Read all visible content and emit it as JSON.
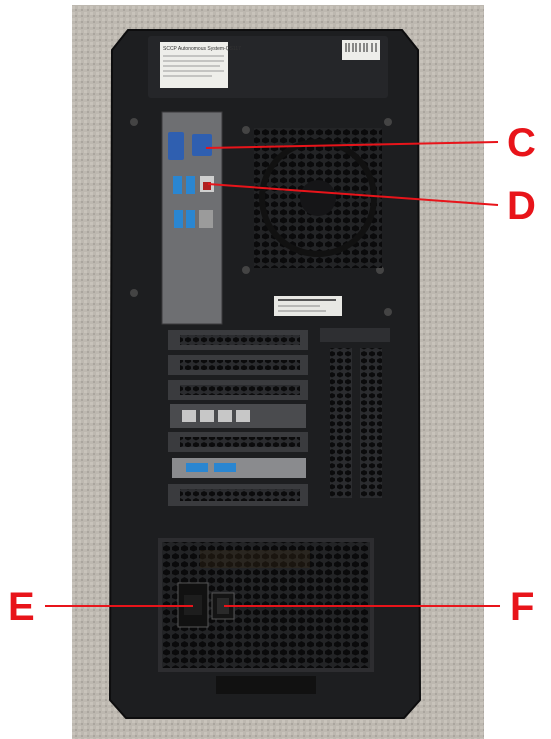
{
  "photo": {
    "subject": "pc-tower-rear-panel",
    "label_top_lines": [
      "SCCP Autonomous System-QS117",
      "",
      "",
      "",
      "",
      ""
    ]
  },
  "callouts": [
    {
      "letter": "C",
      "color": "#e8141a"
    },
    {
      "letter": "D",
      "color": "#e8141a"
    },
    {
      "letter": "E",
      "color": "#e8141a"
    },
    {
      "letter": "F",
      "color": "#e8141a"
    }
  ]
}
